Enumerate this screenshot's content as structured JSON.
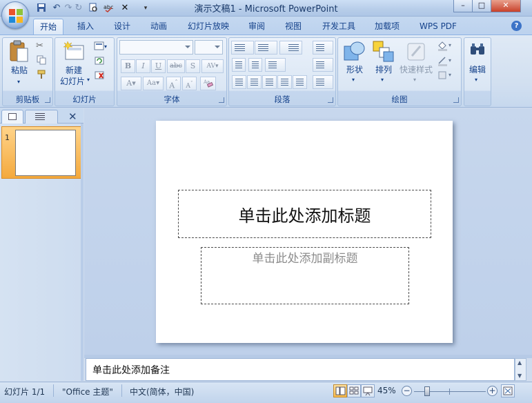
{
  "window": {
    "title": "演示文稿1 - Microsoft PowerPoint",
    "controls": {
      "minimize": "–",
      "maximize": "□",
      "close": "✕"
    }
  },
  "quick_access": {
    "icons": [
      "save-icon",
      "undo-icon",
      "redo-icon",
      "print-preview-icon",
      "spelling-icon",
      "close-icon",
      "customize-dropdown-icon"
    ]
  },
  "tabs": [
    {
      "label": "开始",
      "active": true
    },
    {
      "label": "插入"
    },
    {
      "label": "设计"
    },
    {
      "label": "动画"
    },
    {
      "label": "幻灯片放映"
    },
    {
      "label": "审阅"
    },
    {
      "label": "视图"
    },
    {
      "label": "开发工具"
    },
    {
      "label": "加载项"
    },
    {
      "label": "WPS PDF"
    }
  ],
  "ribbon": {
    "clipboard": {
      "label": "剪贴板",
      "paste": "粘贴"
    },
    "slides": {
      "label": "幻灯片",
      "new_slide_1": "新建",
      "new_slide_2": "幻灯片"
    },
    "font": {
      "label": "字体",
      "font_name": "",
      "font_size": ""
    },
    "paragraph": {
      "label": "段落"
    },
    "drawing": {
      "label": "绘图",
      "shapes": "形状",
      "arrange": "排列",
      "quick_styles": "快速样式"
    },
    "editing": {
      "label": "编辑"
    }
  },
  "slide_panel": {
    "slide_number": "1"
  },
  "slide": {
    "title_placeholder": "单击此处添加标题",
    "subtitle_placeholder": "单击此处添加副标题"
  },
  "notes": {
    "placeholder": "单击此处添加备注"
  },
  "status": {
    "slide_info": "幻灯片 1/1",
    "theme": "\"Office 主题\"",
    "language": "中文(简体，中国)",
    "zoom": "45%"
  },
  "colors": {
    "accent": "#15428b",
    "ribbon_bg": "#d1dff0",
    "selected_thumb": "#f4a93d"
  }
}
